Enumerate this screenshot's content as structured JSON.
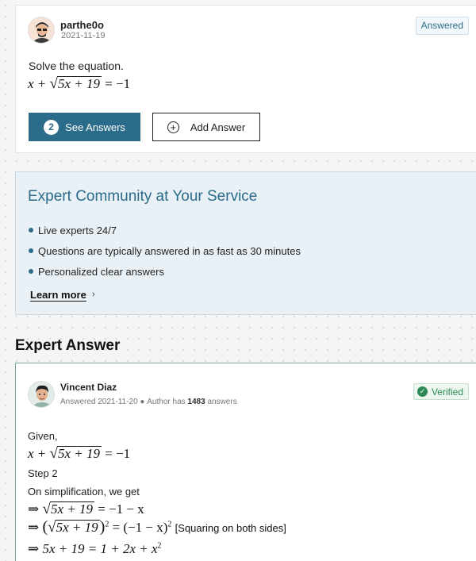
{
  "question": {
    "user_name": "parthe0o",
    "date": "2021-11-19",
    "status_badge": "Answered",
    "text": "Solve the equation.",
    "equation": {
      "lhs_var": "x +",
      "radicand": "5x + 19",
      "rhs": "= −1"
    },
    "see_answers_count": "2",
    "see_answers_label": "See Answers",
    "add_answer_label": "Add Answer"
  },
  "promo": {
    "title": "Expert Community at Your Service",
    "items": [
      "Live experts 24/7",
      "Questions are typically answered in as fast as 30 minutes",
      "Personalized clear answers"
    ],
    "learn_more": "Learn more",
    "learn_more_arrow": "›"
  },
  "expert_answer": {
    "section_title": "Expert Answer",
    "author": "Vincent Diaz",
    "answered_prefix": "Answered 2021-11-20",
    "author_has": "Author has",
    "answer_count": "1483",
    "answers_suffix": "answers",
    "verified_label": "Verified",
    "given_label": "Given,",
    "step_label": "Step 2",
    "simplification_text": "On simplification, we get",
    "eq_given": {
      "lhs_var": "x +",
      "radicand": "5x + 19",
      "rhs": "= −1"
    },
    "eq1": {
      "arrow": "⇒",
      "radicand": "5x + 19",
      "rhs": "= −1 − x"
    },
    "eq2": {
      "arrow": "⇒",
      "radicand": "5x + 19",
      "exponent": "2",
      "rhs": "= (−1 − x)",
      "rhs_exponent": "2",
      "note": "[Squaring on both sides]"
    },
    "eq3": {
      "arrow": "⇒",
      "lhs": "5x + 19 = 1 + 2x + x",
      "exponent": "2"
    }
  },
  "colors": {
    "primary": "#2b6c8a",
    "verified": "#2d8a56",
    "promo_bg": "#e9f1f6"
  }
}
